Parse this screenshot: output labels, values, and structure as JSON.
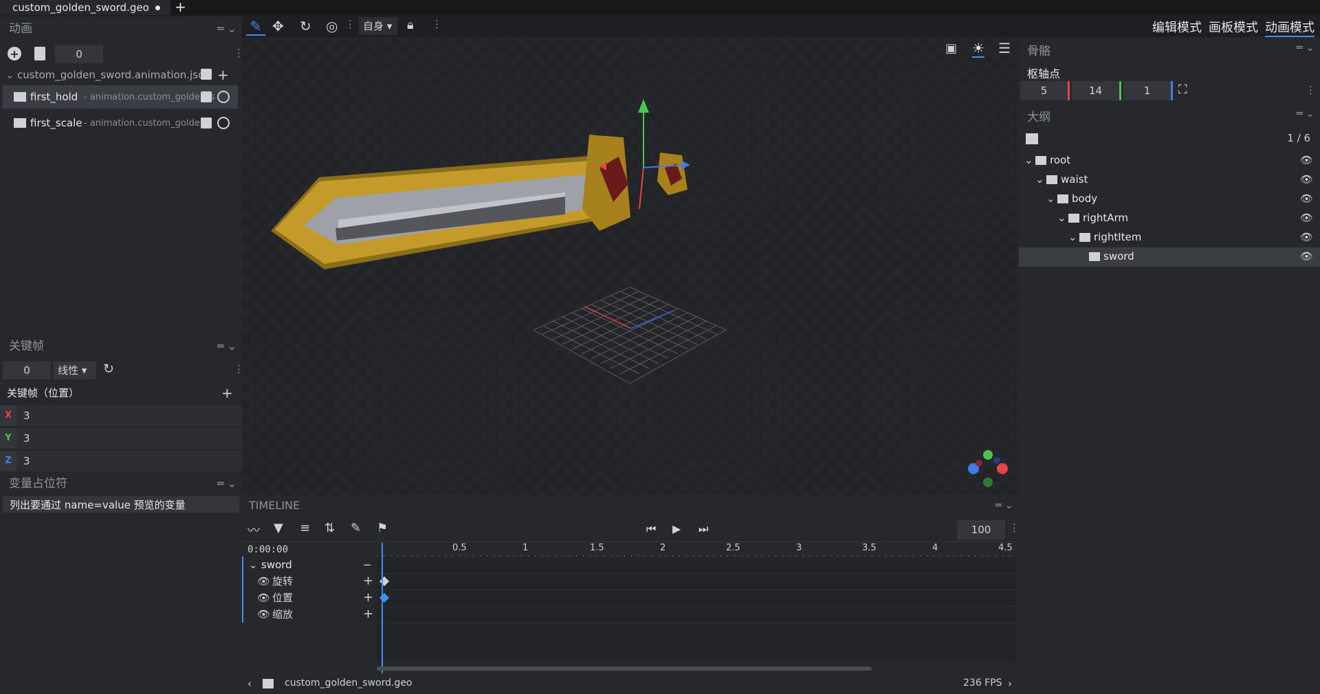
{
  "file_tab": {
    "name": "custom_golden_sword.geo",
    "add": "+"
  },
  "toolbar": {
    "space_label": "自身"
  },
  "modes": {
    "edit": "编辑模式",
    "paint": "画板模式",
    "animate": "动画模式"
  },
  "animation_panel": {
    "title": "动画",
    "frame_value": "0",
    "file": "custom_golden_sword.animation.json",
    "animations": [
      {
        "name": "first_hold",
        "path": "- animation.custom_golden_s"
      },
      {
        "name": "first_scale",
        "path": "- animation.custom_golden_"
      }
    ]
  },
  "keyframe_panel": {
    "title": "关键帧",
    "time_value": "0",
    "interp": "线性",
    "heading": "关键帧（位置）",
    "x_label": "X",
    "x_value": "3",
    "y_label": "Y",
    "y_value": "3",
    "z_label": "Z",
    "z_value": "3"
  },
  "placeholder_panel": {
    "title": "变量占位符",
    "text": "列出要通过 name=value 预览的变量"
  },
  "bone_panel": {
    "title": "骨骼",
    "pivot_label": "枢轴点",
    "pivot": [
      "5",
      "14",
      "1"
    ]
  },
  "outline_panel": {
    "title": "大纲",
    "count": "1 / 6",
    "items": [
      {
        "label": "root"
      },
      {
        "label": "waist"
      },
      {
        "label": "body"
      },
      {
        "label": "rightArm"
      },
      {
        "label": "rightItem"
      },
      {
        "label": "sword"
      }
    ]
  },
  "timeline": {
    "title": "TIMELINE",
    "time": "0:00:00",
    "zoom": "100",
    "ticks": [
      "0.5",
      "1",
      "1.5",
      "2",
      "2.5",
      "3",
      "3.5",
      "4",
      "4.5"
    ],
    "bone": "sword",
    "channels": [
      "旋转",
      "位置",
      "缩放"
    ]
  },
  "status": {
    "file": "custom_golden_sword.geo",
    "fps": "236 FPS"
  },
  "colors": {
    "accent": "#3e90ff",
    "x": "#e8434a",
    "y": "#4ac54f",
    "z": "#3f7ee8"
  }
}
